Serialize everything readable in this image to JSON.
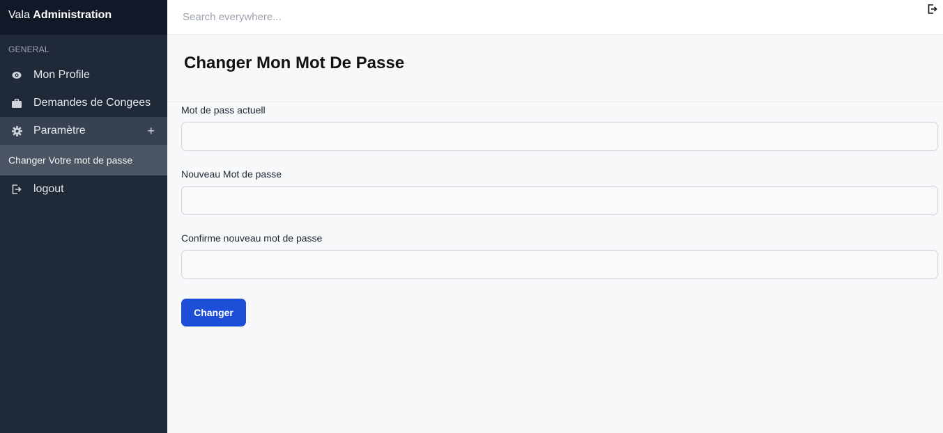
{
  "brand": {
    "prefix": "Vala",
    "name": "Administration"
  },
  "sidebar": {
    "section_label": "GENERAL",
    "items": [
      {
        "label": "Mon Profile",
        "icon": "eye-icon"
      },
      {
        "label": "Demandes de Congees",
        "icon": "briefcase-icon"
      },
      {
        "label": "Paramètre",
        "icon": "gear-icon",
        "expand": "+"
      },
      {
        "label": "logout",
        "icon": "logout-icon"
      }
    ],
    "submenu": {
      "label": "Changer Votre mot de passe"
    }
  },
  "topbar": {
    "search_placeholder": "Search everywhere..."
  },
  "page": {
    "title": "Changer Mon Mot De Passe"
  },
  "form": {
    "current_label": "Mot de pass actuell",
    "current_value": "",
    "new_label": "Nouveau Mot de passe",
    "new_value": "",
    "confirm_label": "Confirme nouveau mot de passe",
    "confirm_value": "",
    "submit_label": "Changer"
  },
  "colors": {
    "sidebar_bg": "#1f2937",
    "brand_bg": "#111827",
    "accent": "#1d4ed8"
  }
}
